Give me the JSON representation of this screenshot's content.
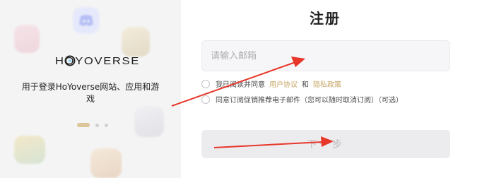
{
  "panel": {
    "logo_text": "HOYOVERSE",
    "description": "用于登录HoYoverse网站、应用和游戏",
    "carousel_total": 3,
    "carousel_active": 1
  },
  "form": {
    "title": "注册",
    "email_placeholder": "请输入邮箱",
    "agree_prefix": "我已阅读并同意",
    "agree_user_agreement": "用户协议",
    "agree_and": "和",
    "agree_privacy_policy": "隐私政策",
    "subscribe_label": "同意订阅促销推荐电子邮件（您可以随时取消订阅）（可选）",
    "next_button": "下一步"
  },
  "colors": {
    "link": "#c8a666",
    "annotation_arrow": "#e8362a",
    "carousel_active": "#dcc59a"
  },
  "icons": [
    "discord-icon",
    "hoyoverse-logo",
    "arrow-annotation"
  ]
}
